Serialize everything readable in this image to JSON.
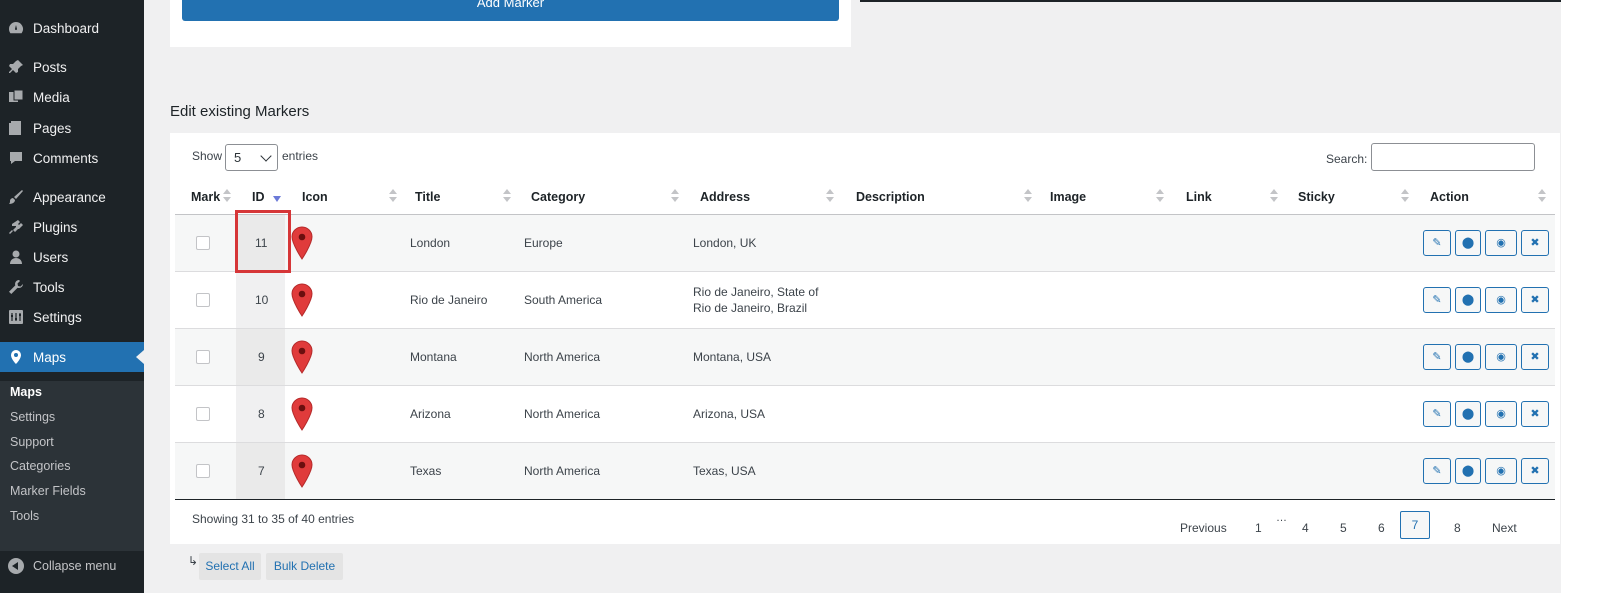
{
  "sidebar": {
    "items": [
      {
        "label": "Dashboard",
        "icon": "dashboard-icon"
      },
      {
        "label": "Posts",
        "icon": "pin-icon"
      },
      {
        "label": "Media",
        "icon": "media-icon"
      },
      {
        "label": "Pages",
        "icon": "pages-icon"
      },
      {
        "label": "Comments",
        "icon": "comments-icon"
      },
      {
        "label": "Appearance",
        "icon": "paintbrush-icon"
      },
      {
        "label": "Plugins",
        "icon": "plugins-icon"
      },
      {
        "label": "Users",
        "icon": "users-icon"
      },
      {
        "label": "Tools",
        "icon": "wrench-icon"
      },
      {
        "label": "Settings",
        "icon": "settings-icon"
      },
      {
        "label": "Maps",
        "icon": "map-marker-icon"
      }
    ],
    "submenu": [
      "Maps",
      "Settings",
      "Support",
      "Categories",
      "Marker Fields",
      "Tools"
    ],
    "collapse_label": "Collapse menu"
  },
  "add_marker_label": "Add Marker",
  "section_title": "Edit existing Markers",
  "table_controls": {
    "show_label": "Show",
    "show_value": "5",
    "entries_label": "entries",
    "search_label": "Search:",
    "search_value": ""
  },
  "columns": [
    "Mark",
    "ID",
    "Icon",
    "Title",
    "Category",
    "Address",
    "Description",
    "Image",
    "Link",
    "Sticky",
    "Action"
  ],
  "rows": [
    {
      "id": "11",
      "title": "London",
      "category": "Europe",
      "address_line1": "London, UK",
      "address_line2": ""
    },
    {
      "id": "10",
      "title": "Rio de Janeiro",
      "category": "South America",
      "address_line1": "Rio de Janeiro, State of",
      "address_line2": "Rio de Janeiro, Brazil"
    },
    {
      "id": "9",
      "title": "Montana",
      "category": "North America",
      "address_line1": "Montana, USA",
      "address_line2": ""
    },
    {
      "id": "8",
      "title": "Arizona",
      "category": "North America",
      "address_line1": "Arizona, USA",
      "address_line2": ""
    },
    {
      "id": "7",
      "title": "Texas",
      "category": "North America",
      "address_line1": "Texas, USA",
      "address_line2": ""
    }
  ],
  "action_icons": [
    "edit-icon",
    "map-marker-icon",
    "eye-icon",
    "delete-icon"
  ],
  "showing_text": "Showing 31 to 35 of 40 entries",
  "pagination": {
    "previous": "Previous",
    "pages": [
      "1",
      "4",
      "5",
      "6",
      "7",
      "8"
    ],
    "ellipsis": "…",
    "current": "7",
    "next": "Next"
  },
  "bulk": {
    "arrow": "↳",
    "select_all": "Select All",
    "bulk_delete": "Bulk Delete"
  },
  "colors": {
    "sidebar_bg": "#1d2327",
    "accent": "#2271b1",
    "highlight_box": "#d63638",
    "pin_red": "#e03b3b"
  }
}
